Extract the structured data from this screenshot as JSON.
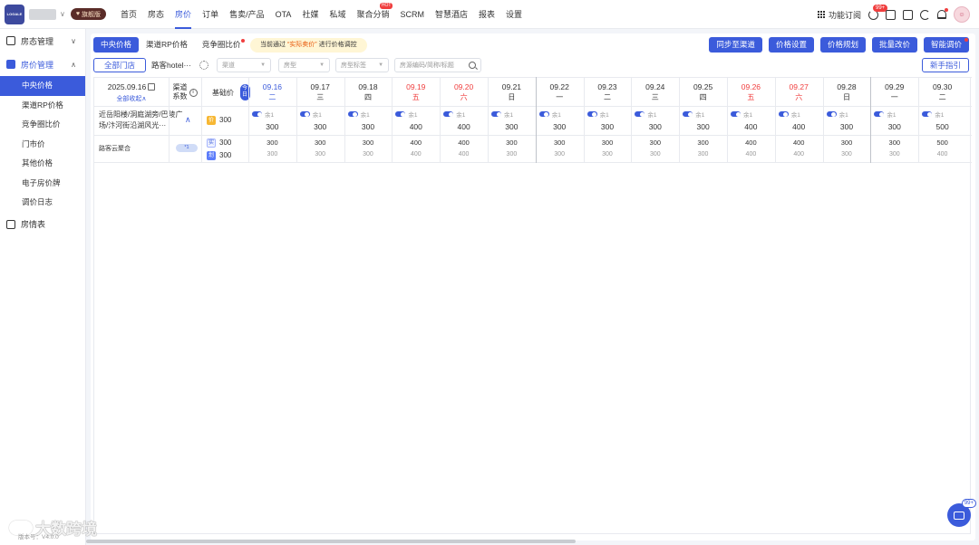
{
  "app": {
    "logo_text": "LOGALE",
    "vip_label": "旗舰版"
  },
  "nav": {
    "items": [
      "首页",
      "房态",
      "房价",
      "订单",
      "售卖/产品",
      "OTA",
      "社媒",
      "私域",
      "聚合分销",
      "SCRM",
      "智慧酒店",
      "报表",
      "设置"
    ],
    "active": "房价",
    "hot_badge": "HOT"
  },
  "topright": {
    "subscription_label": "功能订阅",
    "message_badge": "99+"
  },
  "sidebar": {
    "groups": [
      {
        "label": "房态管理",
        "caret": "∨"
      },
      {
        "label": "房价管理",
        "caret": "∧",
        "active": true
      }
    ],
    "subitems": [
      "中央价格",
      "渠道RP价格",
      "竞争圈比价",
      "门市价",
      "其他价格",
      "电子房价牌",
      "调价日志"
    ],
    "active_sub": "中央价格",
    "bottom_group": "房情表"
  },
  "tabs": [
    "中央价格",
    "渠道RP价格",
    "竞争圈比价"
  ],
  "notice": {
    "prefix": "当前通过",
    "highlight": "“实际卖价”",
    "suffix": "进行价格调控"
  },
  "actions": [
    "同步至渠道",
    "价格设置",
    "价格规划",
    "批量改价",
    "智能调价"
  ],
  "filters": {
    "all_stores": "全部门店",
    "hotel_name": "路客hotel···",
    "channel_placeholder": "渠道",
    "roomtype_placeholder": "房型",
    "roomtag_placeholder": "房型标签",
    "search_placeholder": "房源编码/简称/标题",
    "guide": "新手指引"
  },
  "table": {
    "current_date": "2025.09.16",
    "collapse_all": "全部收起∧",
    "channel_coef_line1": "渠道",
    "channel_coef_line2": "系数",
    "base_price_label": "基础价",
    "today_label": "今日",
    "days": [
      {
        "date": "09.16",
        "weekday": "二",
        "today": true,
        "weekend": false
      },
      {
        "date": "09.17",
        "weekday": "三",
        "weekend": false
      },
      {
        "date": "09.18",
        "weekday": "四",
        "weekend": false
      },
      {
        "date": "09.19",
        "weekday": "五",
        "weekend": true
      },
      {
        "date": "09.20",
        "weekday": "六",
        "weekend": true
      },
      {
        "date": "09.21",
        "weekday": "日",
        "weekend": false
      },
      {
        "date": "09.22",
        "weekday": "一",
        "weekend": false
      },
      {
        "date": "09.23",
        "weekday": "二",
        "weekend": false
      },
      {
        "date": "09.24",
        "weekday": "三",
        "weekend": false
      },
      {
        "date": "09.25",
        "weekday": "四",
        "weekend": false
      },
      {
        "date": "09.26",
        "weekday": "五",
        "weekend": true
      },
      {
        "date": "09.27",
        "weekday": "六",
        "weekend": true
      },
      {
        "date": "09.28",
        "weekday": "日",
        "weekend": false
      },
      {
        "date": "09.29",
        "weekday": "一",
        "weekend": false
      },
      {
        "date": "09.30",
        "weekday": "二",
        "weekend": false
      }
    ],
    "room": {
      "name": "近岳阳楼/洞庭湖旁/巴陵广场/汴河街沿湖风光···",
      "base_icon": "价",
      "base_price": "300",
      "remaining_label": "余1",
      "prices": [
        "300",
        "300",
        "300",
        "400",
        "400",
        "300",
        "300",
        "300",
        "300",
        "300",
        "400",
        "400",
        "300",
        "300",
        "500"
      ]
    },
    "channel": {
      "name": "路客云聚合",
      "tag": "*1",
      "icon1": "实",
      "icon2": "划",
      "base_actual": "300",
      "base_strike": "300",
      "actual": [
        "300",
        "300",
        "300",
        "400",
        "400",
        "300",
        "300",
        "300",
        "300",
        "300",
        "400",
        "400",
        "300",
        "300",
        "500"
      ],
      "strike": [
        "300",
        "300",
        "300",
        "400",
        "400",
        "300",
        "300",
        "300",
        "300",
        "300",
        "400",
        "400",
        "300",
        "300",
        "400"
      ]
    }
  },
  "watermark": {
    "text": "大数跨境",
    "version": "版本号：V4.0.0"
  },
  "chat": {
    "badge": "99+"
  },
  "colors": {
    "primary": "#3b5bdb",
    "weekend": "#f03e3e",
    "notice_bg": "#fff6d5"
  }
}
